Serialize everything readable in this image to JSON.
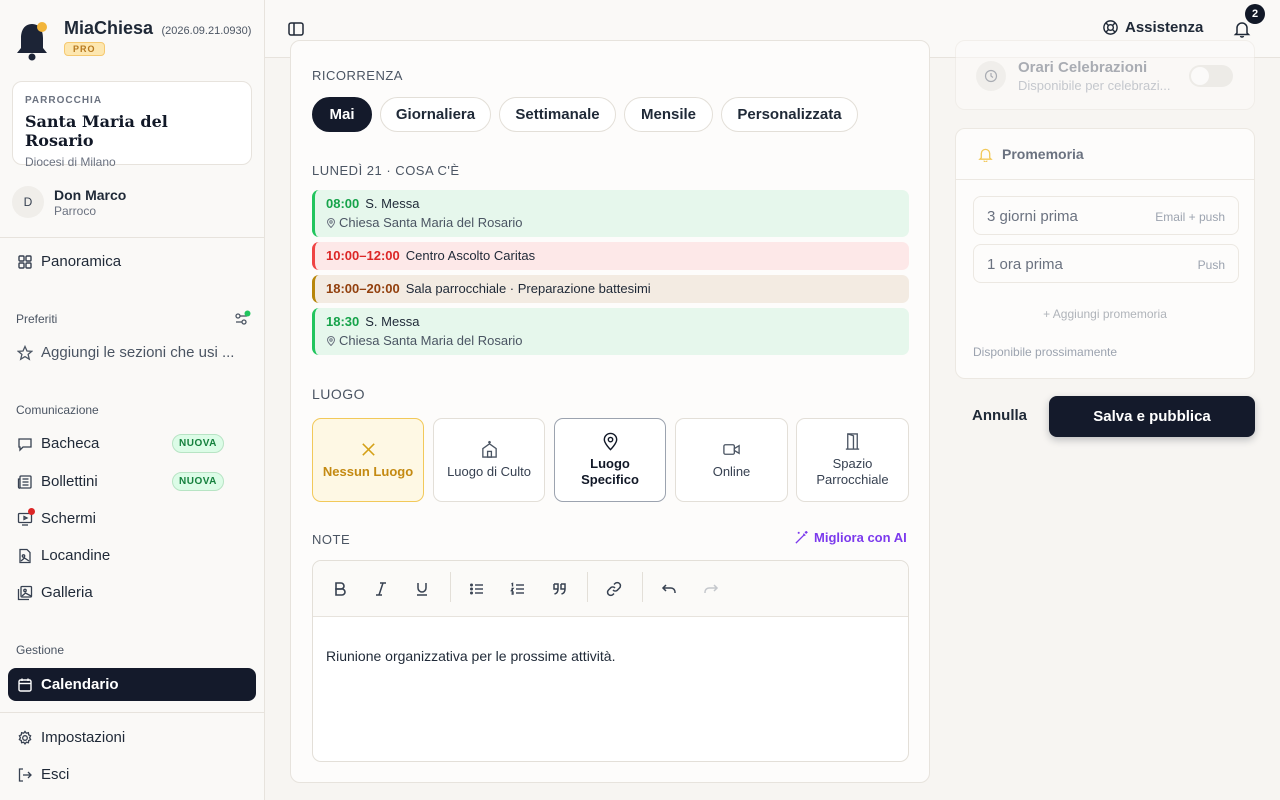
{
  "brand": {
    "name": "MiaChiesa",
    "version": "(2026.09.21.0930)",
    "tier": "PRO"
  },
  "parish": {
    "label": "PARROCCHIA",
    "name": "Santa Maria del Rosario",
    "diocese": "Diocesi di Milano"
  },
  "user": {
    "initial": "D",
    "name": "Don Marco",
    "role": "Parroco"
  },
  "nav": {
    "overview": "Panoramica",
    "favorites_label": "Preferiti",
    "favorites_hint": "Aggiungi le sezioni che usi ...",
    "communication_label": "Comunicazione",
    "communication": [
      {
        "label": "Bacheca",
        "badge": "NUOVA"
      },
      {
        "label": "Bollettini",
        "badge": "NUOVA"
      },
      {
        "label": "Schermi"
      },
      {
        "label": "Locandine"
      },
      {
        "label": "Galleria"
      }
    ],
    "management_label": "Gestione",
    "calendar": "Calendario",
    "settings": "Impostazioni",
    "logout": "Esci"
  },
  "topbar": {
    "assistance": "Assistenza",
    "notifications_count": "2"
  },
  "recurrence": {
    "label": "RICORRENZA",
    "options": [
      "Mai",
      "Giornaliera",
      "Settimanale",
      "Mensile",
      "Personalizzata"
    ],
    "selected": "Mai"
  },
  "day": {
    "label": "LUNEDÌ 21 · COSA C'È",
    "events": [
      {
        "time": "08:00",
        "title": "S. Messa",
        "location": "Chiesa Santa Maria del Rosario",
        "color": "#22c55e"
      },
      {
        "time": "10:00–12:00",
        "title": "Centro Ascolto Caritas",
        "color": "#ef4444"
      },
      {
        "time": "18:00–20:00",
        "title": "Sala parrocchiale · Preparazione battesimi",
        "color": "#b8860b"
      },
      {
        "time": "18:30",
        "title": "S. Messa",
        "location": "Chiesa Santa Maria del Rosario",
        "color": "#22c55e"
      }
    ]
  },
  "place": {
    "label": "LUOGO",
    "options": [
      {
        "label": "Nessun Luogo",
        "icon": "x-icon"
      },
      {
        "label": "Luogo di Culto",
        "icon": "church-icon"
      },
      {
        "label": "Luogo Specifico",
        "icon": "map-pin-icon"
      },
      {
        "label": "Online",
        "icon": "video-icon"
      },
      {
        "label": "Spazio Parrocchiale",
        "icon": "door-icon"
      }
    ],
    "selected": "Nessun Luogo"
  },
  "notes": {
    "label": "NOTE",
    "ai_button": "Migliora con AI",
    "content": "Riunione organizzativa per le prossime attività."
  },
  "celebrations": {
    "title": "Orari Celebrazioni",
    "subtitle": "Disponibile per celebrazi..."
  },
  "reminders": {
    "title": "Promemoria",
    "items": [
      {
        "when": "3 giorni prima",
        "channel": "Email + push"
      },
      {
        "when": "1 ora prima",
        "channel": "Push"
      }
    ],
    "add": "+ Aggiungi promemoria",
    "note": "Disponibile prossimamente"
  },
  "actions": {
    "cancel": "Annulla",
    "publish": "Salva e pubblica"
  },
  "colors": {
    "primary": "#141a2b",
    "accent": "#f2c95a",
    "ai": "#7c3aed"
  }
}
